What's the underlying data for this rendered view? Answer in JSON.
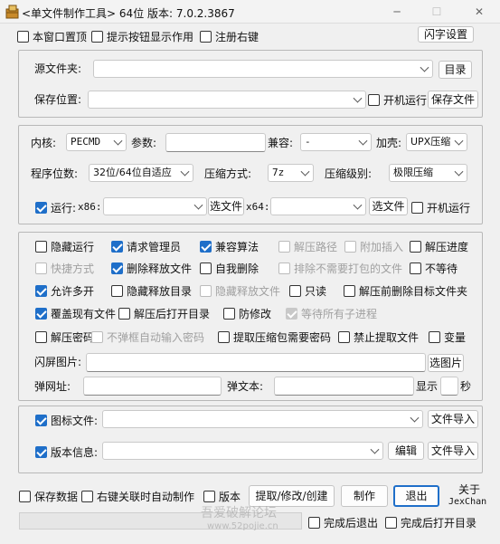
{
  "window": {
    "title": "<单文件制作工具> 64位 版本: 7.0.2.3867",
    "minimize": "─",
    "maximize": "☐",
    "close": "✕"
  },
  "top_options": {
    "stay_on_top": "本窗口置顶",
    "show_tooltips": "提示按钮显示作用",
    "register_context": "注册右键",
    "flash_settings": "闪字设置"
  },
  "source": {
    "source_label": "源文件夹:",
    "source_value": "",
    "browse_dir": "目录",
    "save_label": "保存位置:",
    "save_value": "",
    "run_at_startup": "开机运行",
    "save_file": "保存文件"
  },
  "core": {
    "kernel_label": "内核:",
    "kernel_value": "PECMD",
    "params_label": "参数:",
    "params_value": "",
    "compat_label": "兼容:",
    "compat_value": "-",
    "shell_label": "加壳:",
    "shell_value": "UPX压缩",
    "bits_label": "程序位数:",
    "bits_value": "32位/64位自适应",
    "compress_label": "压缩方式:",
    "compress_value": "7z",
    "level_label": "压缩级别:",
    "level_value": "极限压缩",
    "run_label": "运行:",
    "x86_label": "x86:",
    "x86_value": "",
    "select_file_1": "选文件",
    "x64_label": "x64:",
    "x64_value": "",
    "select_file_2": "选文件",
    "run_startup": "开机运行"
  },
  "options": {
    "rows": [
      [
        {
          "label": "隐藏运行",
          "checked": false,
          "disabled": false
        },
        {
          "label": "请求管理员",
          "checked": true,
          "disabled": false
        },
        {
          "label": "兼容算法",
          "checked": true,
          "disabled": false
        },
        {
          "label": "解压路径",
          "checked": false,
          "disabled": true
        },
        {
          "label": "附加插入",
          "checked": false,
          "disabled": true
        },
        {
          "label": "解压进度",
          "checked": false,
          "disabled": false
        }
      ],
      [
        {
          "label": "快捷方式",
          "checked": false,
          "disabled": true
        },
        {
          "label": "删除释放文件",
          "checked": true,
          "disabled": false
        },
        {
          "label": "自我删除",
          "checked": false,
          "disabled": false
        },
        {
          "label": "排除不需要打包的文件",
          "checked": false,
          "disabled": true
        },
        {
          "label": "不等待",
          "checked": false,
          "disabled": false
        }
      ],
      [
        {
          "label": "允许多开",
          "checked": true,
          "disabled": false
        },
        {
          "label": "隐藏释放目录",
          "checked": false,
          "disabled": false
        },
        {
          "label": "隐藏释放文件",
          "checked": false,
          "disabled": true
        },
        {
          "label": "只读",
          "checked": false,
          "disabled": false
        },
        {
          "label": "解压前删除目标文件夹",
          "checked": false,
          "disabled": false
        }
      ],
      [
        {
          "label": "覆盖现有文件",
          "checked": true,
          "disabled": false
        },
        {
          "label": "解压后打开目录",
          "checked": false,
          "disabled": false
        },
        {
          "label": "防修改",
          "checked": false,
          "disabled": false
        },
        {
          "label": "等待所有子进程",
          "checked": true,
          "disabled": true
        }
      ],
      [
        {
          "label": "解压密码",
          "checked": false,
          "disabled": false
        },
        {
          "label": "不弹框自动输入密码",
          "checked": false,
          "disabled": true
        },
        {
          "label": "提取压缩包需要密码",
          "checked": false,
          "disabled": false
        },
        {
          "label": "禁止提取文件",
          "checked": false,
          "disabled": false
        },
        {
          "label": "变量",
          "checked": false,
          "disabled": false
        }
      ]
    ],
    "splash_label": "闪屏图片:",
    "splash_value": "",
    "choose_image": "选图片",
    "popup_url_label": "弹网址:",
    "popup_url_value": "",
    "popup_text_label": "弹文本:",
    "popup_text_value": "",
    "show_label": "显示",
    "seconds_value": "",
    "seconds_label": "秒"
  },
  "resources": {
    "icon_label": "图标文件:",
    "icon_value": "",
    "icon_import": "文件导入",
    "version_label": "版本信息:",
    "version_value": "",
    "edit": "编辑",
    "version_import": "文件导入"
  },
  "bottom": {
    "save_data": "保存数据",
    "context_auto": "右键关联时自动制作",
    "version": "版本",
    "extract": "提取/修改/创建",
    "make": "制作",
    "exit": "退出",
    "about": "关于",
    "author": "JexChan",
    "exit_after": "完成后退出",
    "open_after": "完成后打开目录",
    "progress": 0
  },
  "watermark": {
    "line1": "吾爱破解论坛",
    "line2": "www.52pojie.cn"
  }
}
